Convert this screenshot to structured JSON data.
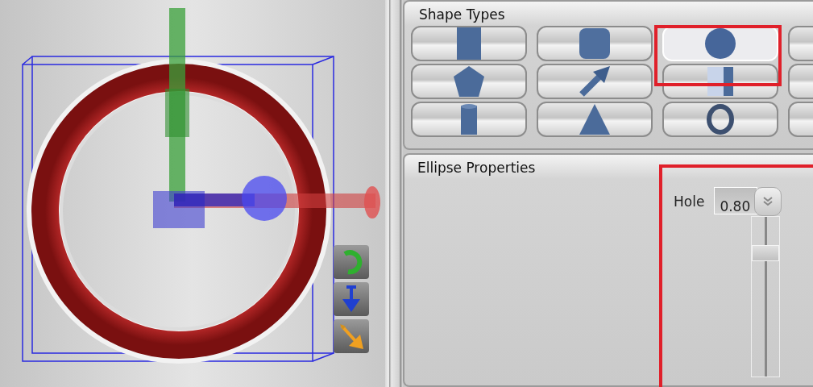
{
  "shape_types": {
    "title": "Shape Types",
    "buttons": [
      {
        "kind": "cube",
        "selected": false
      },
      {
        "kind": "rounded-cube",
        "selected": false
      },
      {
        "kind": "sphere",
        "selected": true
      },
      {
        "kind": "unknown",
        "selected": false
      },
      {
        "kind": "pentagon",
        "selected": false
      },
      {
        "kind": "arrow",
        "selected": false
      },
      {
        "kind": "box",
        "selected": false
      },
      {
        "kind": "unknown",
        "selected": false
      },
      {
        "kind": "cylinder",
        "selected": false
      },
      {
        "kind": "cone",
        "selected": false
      },
      {
        "kind": "torus",
        "selected": false
      },
      {
        "kind": "unknown",
        "selected": false
      }
    ]
  },
  "ellipse_properties": {
    "title": "Ellipse Properties",
    "hole": {
      "label": "Hole",
      "value": "0.80",
      "level": 0.8
    }
  }
}
